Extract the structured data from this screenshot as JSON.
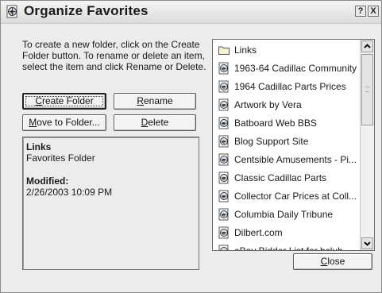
{
  "window": {
    "title": "Organize Favorites",
    "title_icon": "favorites-page-icon",
    "help_button": "?",
    "close_button": "X"
  },
  "instructions": "To create a new folder, click on the Create Folder button. To rename or delete an item, select the item and click Rename or Delete.",
  "buttons": {
    "create_folder": {
      "pre": "",
      "mnemonic": "C",
      "post": "reate Folder"
    },
    "rename": {
      "pre": "",
      "mnemonic": "R",
      "post": "ename"
    },
    "move_to_folder": {
      "pre": "",
      "mnemonic": "M",
      "post": "ove to Folder..."
    },
    "delete": {
      "pre": "",
      "mnemonic": "D",
      "post": "elete"
    },
    "close": {
      "pre": "",
      "mnemonic": "C",
      "post": "lose"
    }
  },
  "info": {
    "name": "Links",
    "type": "Favorites Folder",
    "modified_label": "Modified:",
    "modified_value": "2/26/2003 10:09 PM"
  },
  "favorites_list": [
    {
      "label": "Links",
      "icon": "folder-icon"
    },
    {
      "label": "1963-64 Cadillac Community",
      "icon": "web-page-icon"
    },
    {
      "label": "1964 Cadillac Parts Prices",
      "icon": "web-page-icon"
    },
    {
      "label": "Artwork by Vera",
      "icon": "web-page-icon"
    },
    {
      "label": "Batboard Web BBS",
      "icon": "web-page-icon"
    },
    {
      "label": "Blog Support Site",
      "icon": "web-page-icon"
    },
    {
      "label": "Centsible Amusements - Pi...",
      "icon": "web-page-icon"
    },
    {
      "label": "Classic Cadillac Parts",
      "icon": "web-page-icon"
    },
    {
      "label": "Collector Car Prices at Coll...",
      "icon": "web-page-icon"
    },
    {
      "label": "Columbia Daily Tribune",
      "icon": "web-page-icon"
    },
    {
      "label": "Dilbert.com",
      "icon": "web-page-icon"
    },
    {
      "label": "eBay Bidder List for bcluh",
      "icon": "web-page-icon"
    }
  ]
}
